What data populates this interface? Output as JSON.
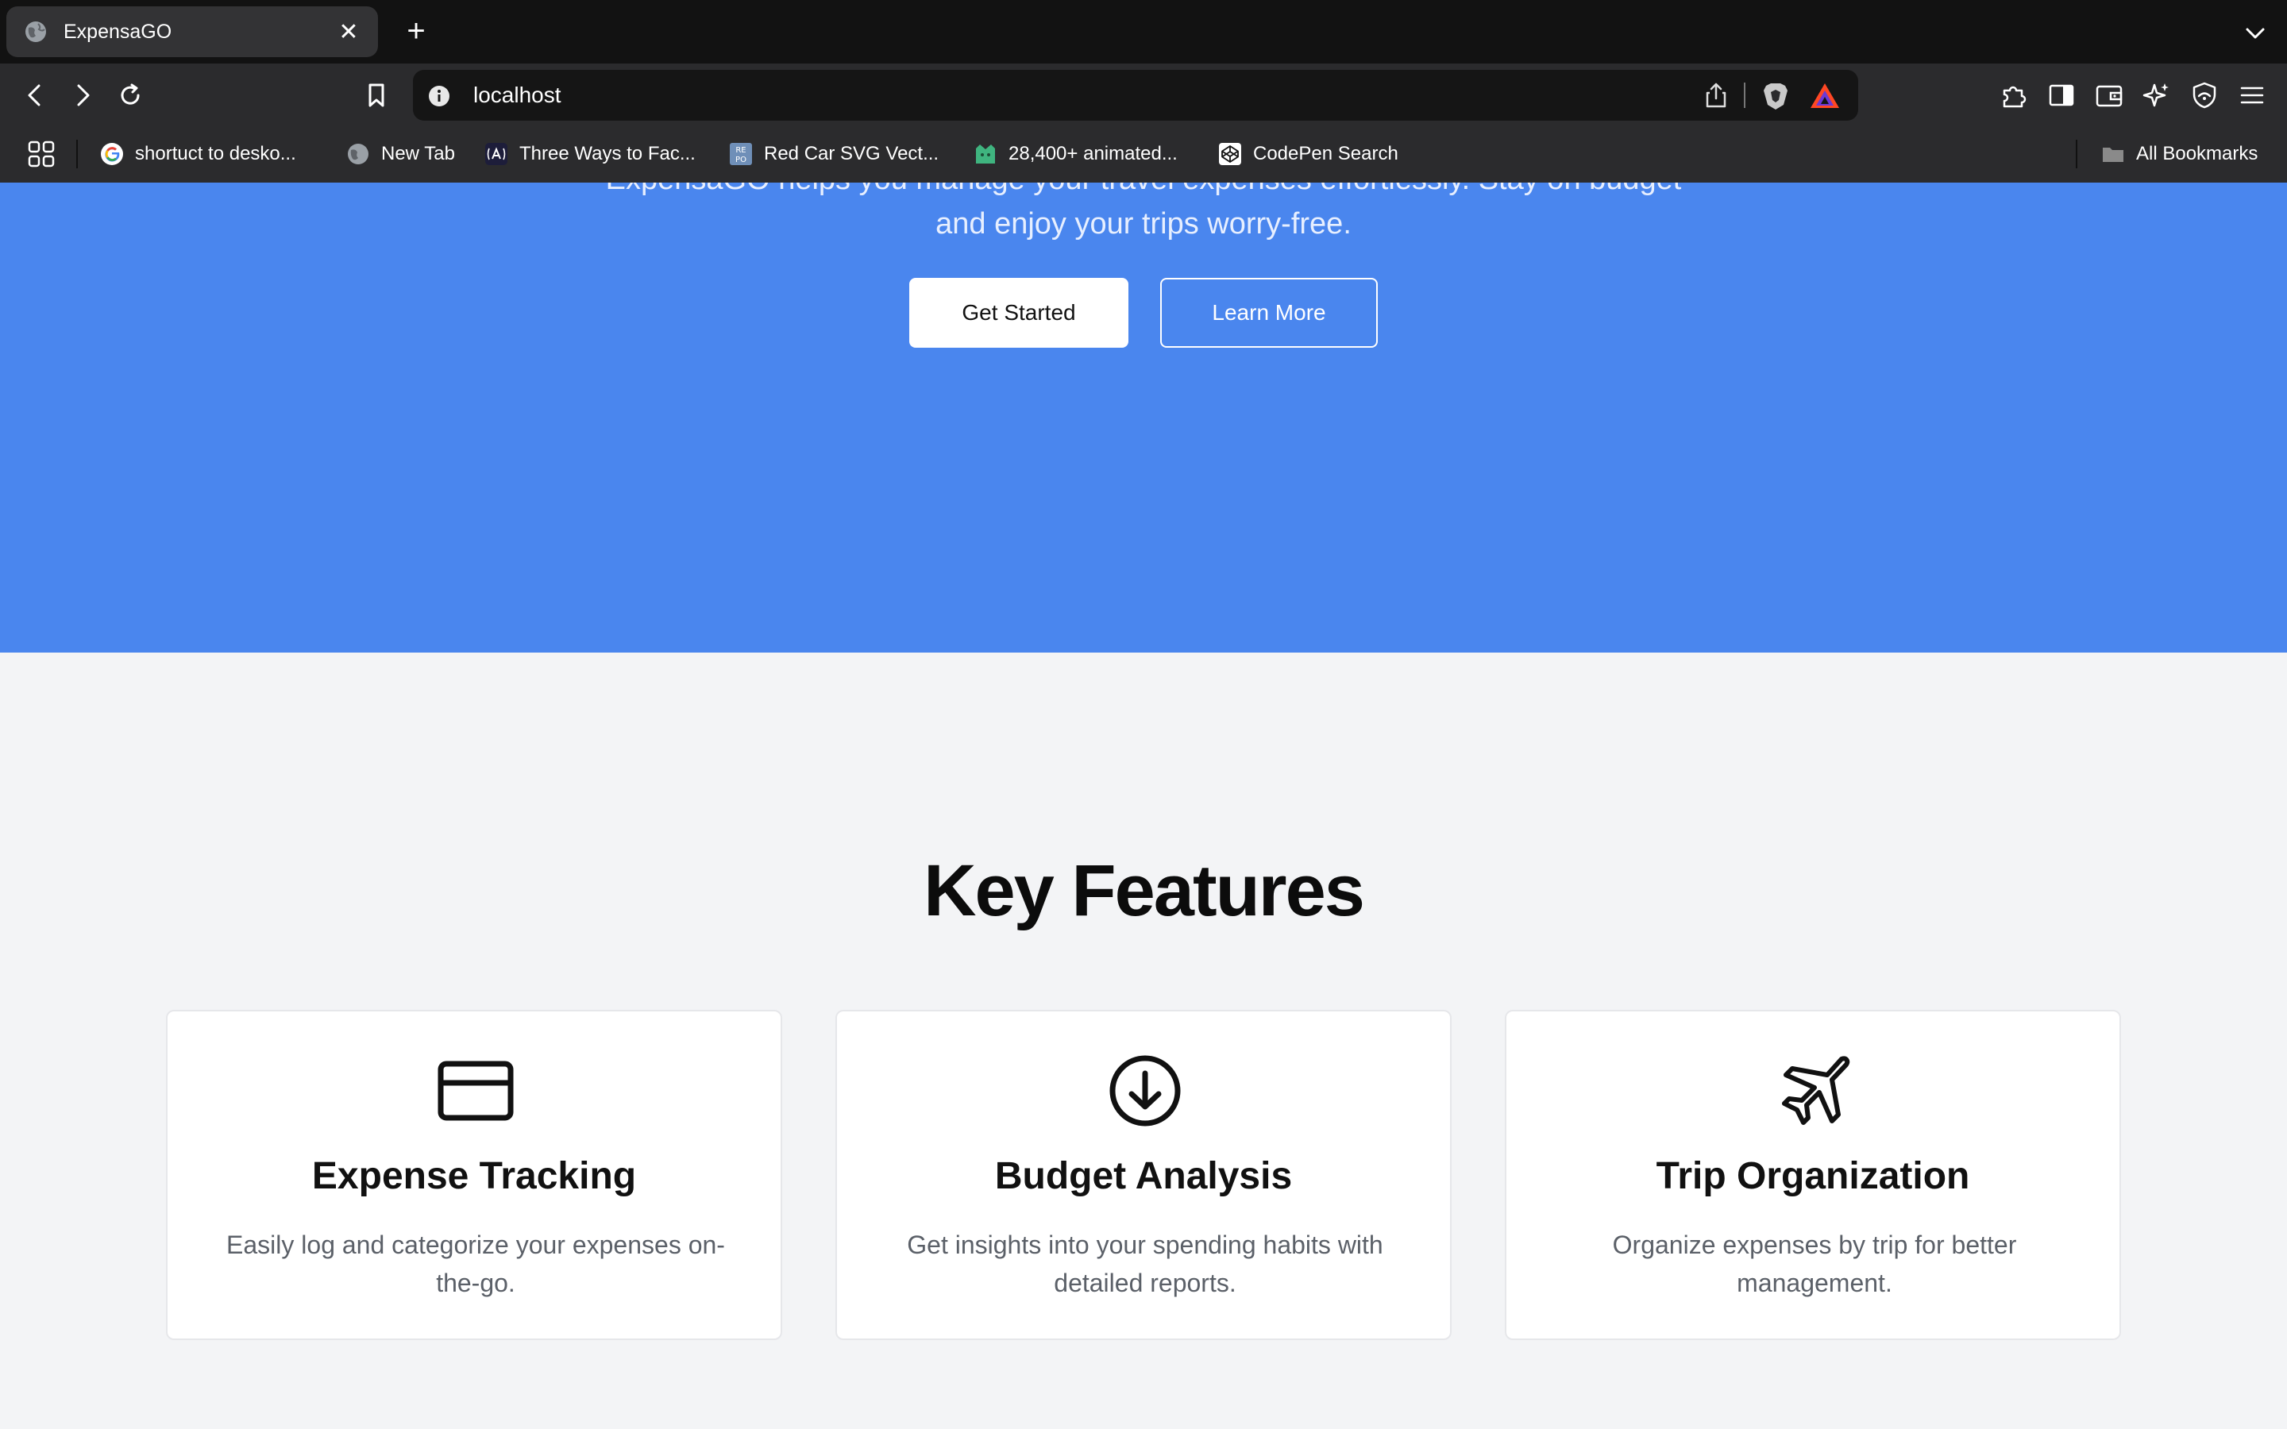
{
  "browser": {
    "tab_title": "ExpensaGO",
    "url": "localhost",
    "bookmarks": [
      {
        "label": "shortuct to desko...",
        "icon": "google-icon"
      },
      {
        "label": "New Tab",
        "icon": "globe-icon"
      },
      {
        "label": "Three Ways to Fac...",
        "icon": "site-icon"
      },
      {
        "label": "Red Car SVG Vect...",
        "icon": "svgrepo-icon"
      },
      {
        "label": "28,400+ animated...",
        "icon": "site-icon"
      },
      {
        "label": "CodePen Search",
        "icon": "codepen-icon"
      }
    ],
    "all_bookmarks": "All Bookmarks"
  },
  "hero": {
    "subtitle": "ExpensaGO helps you manage your travel expenses effortlessly. Stay on budget and enjoy your trips worry-free.",
    "primary_button": "Get Started",
    "secondary_button": "Learn More",
    "background_color": "#4a86ee"
  },
  "features": {
    "title": "Key Features",
    "cards": [
      {
        "title": "Expense Tracking",
        "description": "Easily log and categorize your expenses on-the-go.",
        "icon": "credit-card-icon"
      },
      {
        "title": "Budget Analysis",
        "description": "Get insights into your spending habits with detailed reports.",
        "icon": "arrow-down-circle-icon"
      },
      {
        "title": "Trip Organization",
        "description": "Organize expenses by trip for better management.",
        "icon": "airplane-icon"
      }
    ]
  }
}
